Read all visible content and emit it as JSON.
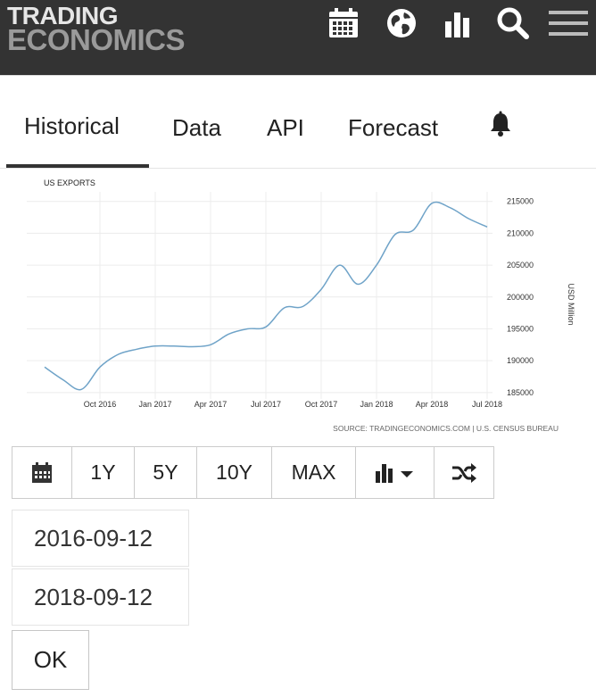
{
  "header": {
    "logo_line1": "TRADING",
    "logo_line2": "ECONOMICS",
    "icons": [
      "calendar-icon",
      "globe-icon",
      "bar-chart-icon",
      "search-icon",
      "menu-icon"
    ]
  },
  "tabs": [
    {
      "label": "Historical",
      "active": true
    },
    {
      "label": "Data"
    },
    {
      "label": "API"
    },
    {
      "label": "Forecast"
    }
  ],
  "tabs_icon": "bell-icon",
  "chart_data": {
    "type": "line",
    "title": "US EXPORTS",
    "ylabel": "USD Million",
    "source": "SOURCE: TRADINGECONOMICS.COM | U.S. CENSUS BUREAU",
    "ylim": [
      184000,
      216500
    ],
    "yticks": [
      185000,
      190000,
      195000,
      200000,
      205000,
      210000,
      215000
    ],
    "xticks": [
      "Oct 2016",
      "Jan 2017",
      "Apr 2017",
      "Jul 2017",
      "Oct 2017",
      "Jan 2018",
      "Apr 2018",
      "Jul 2018"
    ],
    "series": [
      {
        "color": "#6fa3c8",
        "x": [
          "Jul 2016",
          "Aug 2016",
          "Sep 2016",
          "Oct 2016",
          "Nov 2016",
          "Dec 2016",
          "Jan 2017",
          "Feb 2017",
          "Mar 2017",
          "Apr 2017",
          "May 2017",
          "Jun 2017",
          "Jul 2017",
          "Aug 2017",
          "Sep 2017",
          "Oct 2017",
          "Nov 2017",
          "Dec 2017",
          "Jan 2018",
          "Feb 2018",
          "Mar 2018",
          "Apr 2018",
          "May 2018",
          "Jun 2018",
          "Jul 2018"
        ],
        "values": [
          189000,
          187000,
          185500,
          189000,
          191000,
          191800,
          192300,
          192300,
          192200,
          192500,
          194200,
          195000,
          195300,
          198300,
          198500,
          201200,
          205000,
          202000,
          205000,
          209800,
          210500,
          214700,
          214000,
          212300,
          211000
        ]
      }
    ]
  },
  "toolbar": {
    "buttons": [
      {
        "icon": "calendar-icon"
      },
      {
        "label": "1Y"
      },
      {
        "label": "5Y"
      },
      {
        "label": "10Y"
      },
      {
        "label": "MAX"
      },
      {
        "icon": "chart-type-icon"
      },
      {
        "icon": "shuffle-icon"
      }
    ]
  },
  "date_range": {
    "start": "2016-09-12",
    "end": "2018-09-12",
    "ok_label": "OK"
  }
}
